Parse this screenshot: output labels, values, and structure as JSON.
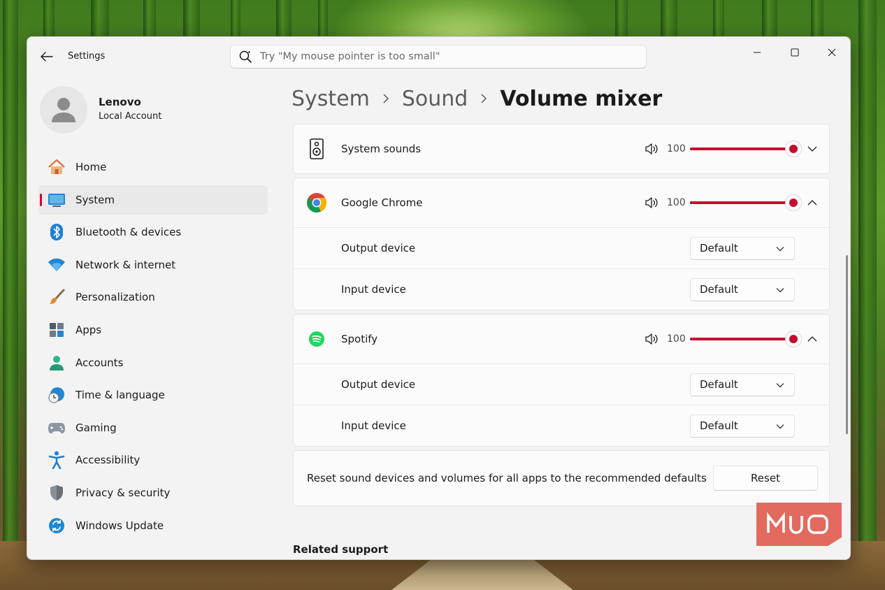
{
  "window": {
    "title": "Settings"
  },
  "search": {
    "placeholder": "Try \"My mouse pointer is too small\""
  },
  "profile": {
    "name": "Lenovo",
    "account_type": "Local Account"
  },
  "nav": {
    "active": "System",
    "items": [
      {
        "label": "Home",
        "icon": "home-icon"
      },
      {
        "label": "System",
        "icon": "system-icon"
      },
      {
        "label": "Bluetooth & devices",
        "icon": "bluetooth-icon"
      },
      {
        "label": "Network & internet",
        "icon": "wifi-icon"
      },
      {
        "label": "Personalization",
        "icon": "brush-icon"
      },
      {
        "label": "Apps",
        "icon": "apps-icon"
      },
      {
        "label": "Accounts",
        "icon": "accounts-icon"
      },
      {
        "label": "Time & language",
        "icon": "clock-globe-icon"
      },
      {
        "label": "Gaming",
        "icon": "gamepad-icon"
      },
      {
        "label": "Accessibility",
        "icon": "accessibility-icon"
      },
      {
        "label": "Privacy & security",
        "icon": "shield-icon"
      },
      {
        "label": "Windows Update",
        "icon": "update-icon"
      }
    ]
  },
  "breadcrumb": {
    "items": [
      "System",
      "Sound",
      "Volume mixer"
    ]
  },
  "apps": [
    {
      "name": "System sounds",
      "icon": "speaker-device-icon",
      "volume": "100",
      "volume_level": 1.0,
      "expanded": false
    },
    {
      "name": "Google Chrome",
      "icon": "chrome-icon",
      "volume": "100",
      "volume_level": 1.0,
      "expanded": true,
      "output_label": "Output device",
      "output_value": "Default",
      "input_label": "Input device",
      "input_value": "Default"
    },
    {
      "name": "Spotify",
      "icon": "spotify-icon",
      "volume": "100",
      "volume_level": 1.0,
      "expanded": true,
      "output_label": "Output device",
      "output_value": "Default",
      "input_label": "Input device",
      "input_value": "Default"
    }
  ],
  "reset": {
    "description": "Reset sound devices and volumes for all apps to the recommended defaults",
    "button_label": "Reset"
  },
  "related_support": {
    "heading": "Related support"
  },
  "colors": {
    "accent": "#c3102f",
    "watermark": "#e26a5e"
  }
}
